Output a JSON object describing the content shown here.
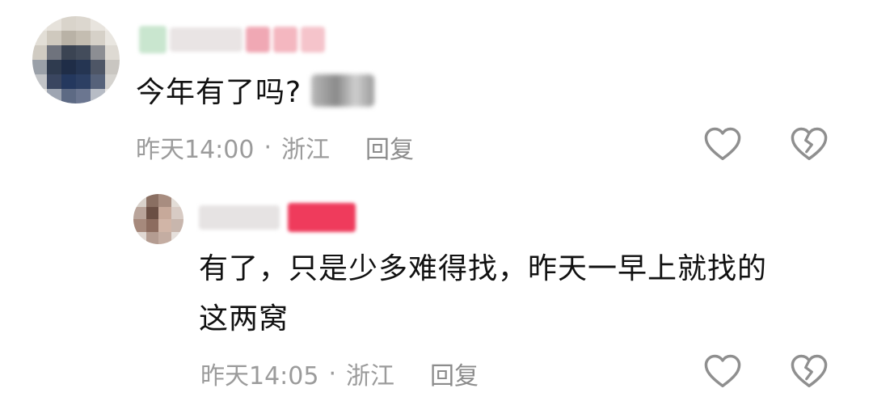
{
  "comments": [
    {
      "content": "今年有了吗?",
      "time": "昨天14:00",
      "separator": "·",
      "location": "浙江",
      "reply_label": "回复",
      "like_icon": "heart-outline-icon",
      "dislike_icon": "broken-heart-icon"
    },
    {
      "content_line1": "有了，只是少多难得找，昨天一早上就找的",
      "content_line2": "这两窝",
      "time": "昨天14:05",
      "separator": "·",
      "location": "浙江",
      "reply_label": "回复",
      "like_icon": "heart-outline-icon",
      "dislike_icon": "broken-heart-icon"
    }
  ],
  "colors": {
    "text": "#111111",
    "meta": "#9b9b9b",
    "badge": "#ef3b5c",
    "icon": "#8f8f8f"
  }
}
